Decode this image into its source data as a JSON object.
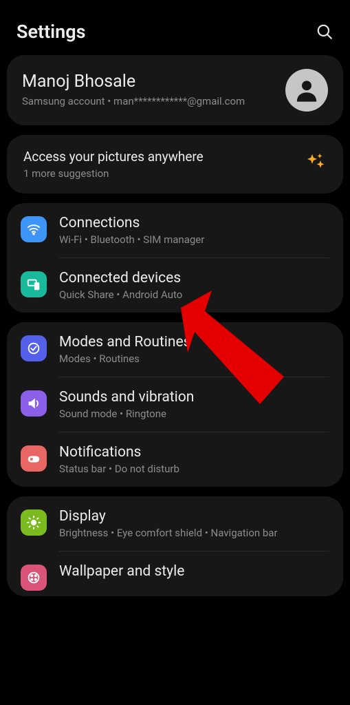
{
  "header": {
    "title": "Settings"
  },
  "profile": {
    "name": "Manoj Bhosale",
    "sub": "Samsung account • man************@gmail.com"
  },
  "suggestion": {
    "title": "Access your pictures anywhere",
    "sub": "1 more suggestion"
  },
  "groups": [
    {
      "items": [
        {
          "title": "Connections",
          "sub": "Wi-Fi • Bluetooth • SIM manager"
        },
        {
          "title": "Connected devices",
          "sub": "Quick Share • Android Auto"
        }
      ]
    },
    {
      "items": [
        {
          "title": "Modes and Routines",
          "sub": "Modes • Routines"
        },
        {
          "title": "Sounds and vibration",
          "sub": "Sound mode • Ringtone"
        },
        {
          "title": "Notifications",
          "sub": "Status bar • Do not disturb"
        }
      ]
    },
    {
      "items": [
        {
          "title": "Display",
          "sub": "Brightness • Eye comfort shield • Navigation bar"
        },
        {
          "title": "Wallpaper and style",
          "sub": ""
        }
      ]
    }
  ]
}
